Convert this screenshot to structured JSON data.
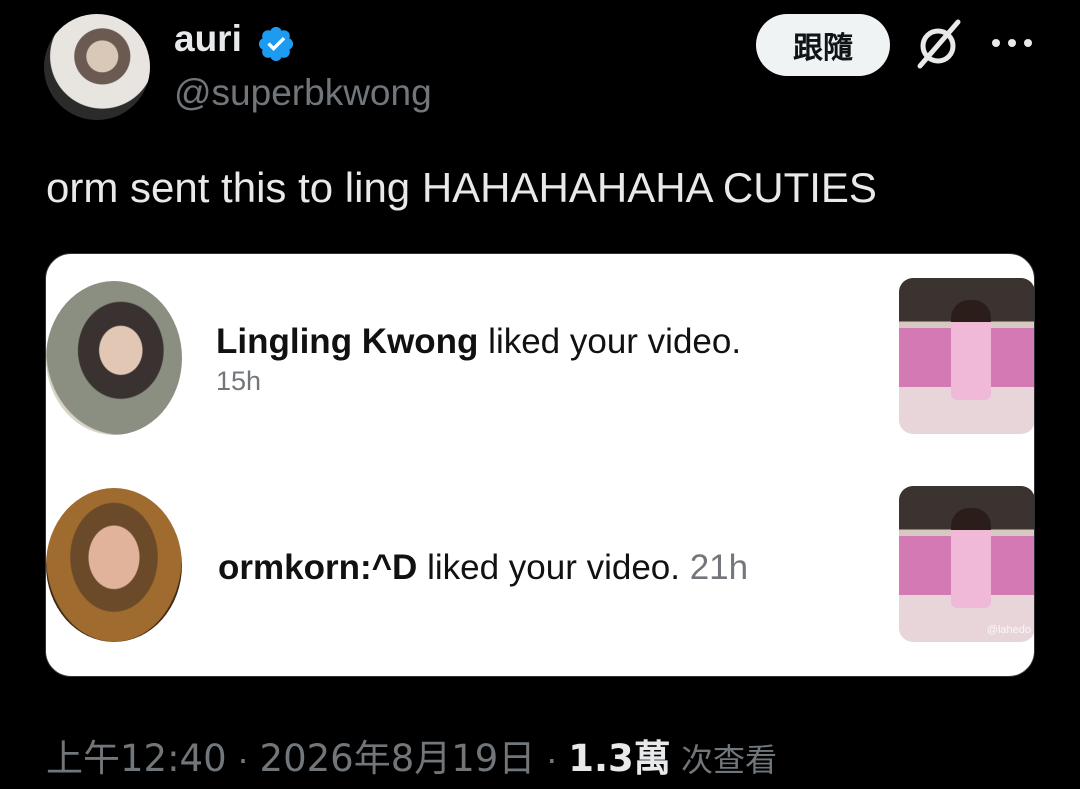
{
  "user": {
    "display_name": "auri",
    "handle": "@superbkwong",
    "verified": true,
    "verified_color": "#1d9bf0"
  },
  "actions": {
    "follow_label": "跟隨",
    "grok_icon": "grok-slash-icon",
    "more_icon": "more-dots-icon"
  },
  "tweet": {
    "text": "orm sent this to ling HAHAHAHAHA CUTIES"
  },
  "media": {
    "notifications": [
      {
        "name": "Lingling Kwong",
        "action": " liked your video.",
        "time": "15h"
      },
      {
        "name": "ormkorn:^D",
        "action": " liked your video.",
        "time": "21h"
      }
    ],
    "watermark": "@lahedo"
  },
  "meta": {
    "time": "上午12:40",
    "date": "2026年8月19日",
    "views": "1.3萬",
    "views_label": "次查看"
  }
}
